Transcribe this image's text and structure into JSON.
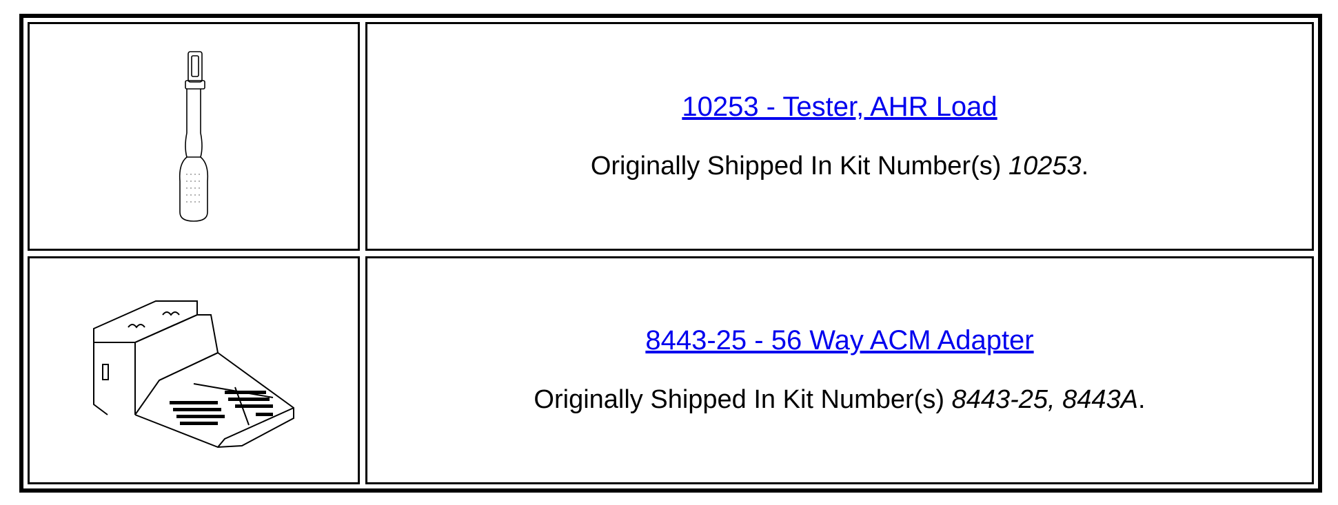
{
  "rows": [
    {
      "image_icon": "screwdriver-tester-drawing",
      "title": "10253 - Tester, AHR Load",
      "kit_prefix": "Originally Shipped In Kit Number(s) ",
      "kit_numbers": "10253",
      "kit_suffix": "."
    },
    {
      "image_icon": "acm-adapter-drawing",
      "title": "8443-25 - 56 Way ACM Adapter",
      "kit_prefix": "Originally Shipped In Kit Number(s) ",
      "kit_numbers": "8443-25, 8443A",
      "kit_suffix": "."
    }
  ],
  "colors": {
    "link": "#0000ee",
    "border": "#000000",
    "text": "#000000"
  }
}
